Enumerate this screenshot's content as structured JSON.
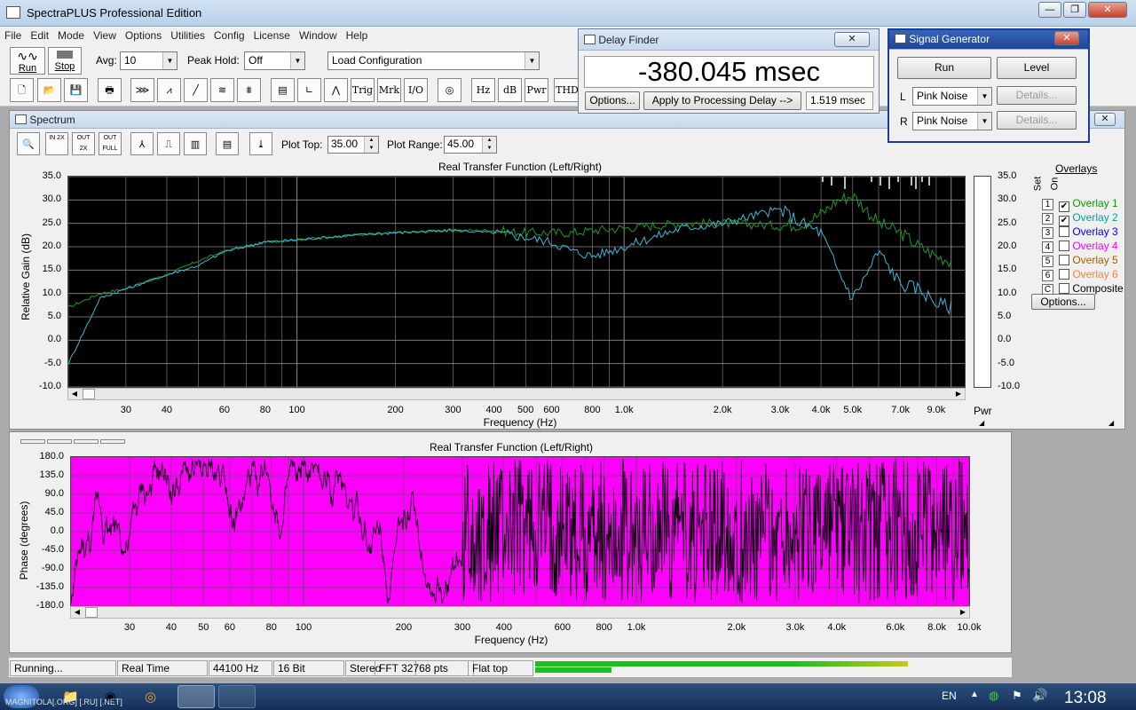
{
  "app": {
    "title": "SpectraPLUS Professional Edition"
  },
  "menu": [
    "File",
    "Edit",
    "Mode",
    "View",
    "Options",
    "Utilities",
    "Config",
    "License",
    "Window",
    "Help"
  ],
  "toolbar": {
    "run_label": "Run",
    "stop_label": "Stop",
    "avg_label": "Avg:",
    "avg_value": "10",
    "peak_hold_label": "Peak Hold:",
    "peak_hold_value": "Off",
    "config_value": "Load Configuration",
    "text_buttons": [
      "Trig",
      "Mrk",
      "I/O",
      "Hz",
      "dB",
      "Pwr",
      "THD"
    ]
  },
  "spectrum": {
    "window_title": "Spectrum",
    "plot_top_label": "Plot Top:",
    "plot_top_value": "35.00",
    "plot_range_label": "Plot Range:",
    "plot_range_value": "45.00",
    "mini_buttons": [
      "IN 2X",
      "OUT 2X",
      "OUT FULL"
    ],
    "pwr_label": "Pwr",
    "overlays": {
      "title": "Overlays",
      "set_label": "Set",
      "on_label": "On",
      "rows": [
        {
          "num": "1",
          "label": "Overlay 1",
          "checked": true,
          "color": "#00a000"
        },
        {
          "num": "2",
          "label": "Overlay 2",
          "checked": true,
          "color": "#00a0a0"
        },
        {
          "num": "3",
          "label": "Overlay 3",
          "checked": false,
          "color": "#0000ff"
        },
        {
          "num": "4",
          "label": "Overlay 4",
          "checked": false,
          "color": "#ff00ff"
        },
        {
          "num": "5",
          "label": "Overlay 5",
          "checked": false,
          "color": "#a06000"
        },
        {
          "num": "6",
          "label": "Overlay 6",
          "checked": false,
          "color": "#ff8040"
        },
        {
          "num": "C",
          "label": "Composite",
          "checked": false,
          "color": "#000000"
        }
      ],
      "options_label": "Options..."
    }
  },
  "delay_finder": {
    "title": "Delay Finder",
    "value": "-380.045 msec",
    "options_label": "Options...",
    "apply_label": "Apply to Processing Delay -->",
    "delay_value": "1.519 msec"
  },
  "signal_generator": {
    "title": "Signal Generator",
    "run_label": "Run",
    "level_label": "Level",
    "left_label": "L",
    "right_label": "R",
    "left_value": "Pink Noise",
    "right_value": "Pink Noise",
    "details_label": "Details..."
  },
  "chart_data": [
    {
      "type": "line",
      "title": "Real Transfer Function (Left/Right)",
      "xlabel": "Frequency (Hz)",
      "ylabel": "Relative Gain (dB)",
      "x_scale": "log",
      "xlim": [
        20,
        11000
      ],
      "ylim": [
        -10,
        35
      ],
      "y_ticks": [
        "35.0",
        "30.0",
        "25.0",
        "20.0",
        "15.0",
        "10.0",
        "5.0",
        "0.0",
        "-5.0",
        "-10.0"
      ],
      "x_ticks": [
        "30",
        "40",
        "60",
        "80",
        "100",
        "200",
        "300",
        "400",
        "500",
        "600",
        "800",
        "1.0k",
        "2.0k",
        "3.0k",
        "4.0k",
        "5.0k",
        "7.0k",
        "9.0k"
      ],
      "grid": true,
      "background": "#000000",
      "series": [
        {
          "color": "#1e9a1e",
          "x": [
            20,
            25,
            30,
            40,
            50,
            60,
            80,
            100,
            150,
            200,
            300,
            400,
            500,
            600,
            700,
            800,
            1000,
            1500,
            2000,
            3000,
            3500,
            4000,
            4500,
            5000,
            5500,
            6000,
            7000,
            8000,
            9000,
            10000
          ],
          "y": [
            7,
            10,
            11,
            14,
            17,
            19,
            21,
            21.5,
            22.5,
            23,
            23.5,
            23.5,
            23,
            23,
            23,
            23.5,
            24,
            25,
            25,
            24.5,
            25,
            27,
            30,
            31,
            28,
            25,
            23,
            20,
            18,
            17
          ]
        },
        {
          "color": "#3fb6d8",
          "x": [
            20,
            25,
            30,
            40,
            50,
            60,
            80,
            100,
            150,
            200,
            300,
            400,
            500,
            600,
            700,
            800,
            1000,
            1500,
            2000,
            3000,
            3500,
            4000,
            4500,
            5000,
            5500,
            6000,
            7000,
            8000,
            9000,
            10000
          ],
          "y": [
            -5,
            9,
            11,
            14,
            16,
            19,
            21,
            21.5,
            22.5,
            23,
            23.5,
            23,
            22,
            21,
            19,
            18,
            20,
            24,
            25,
            28,
            25,
            23,
            15,
            9,
            14,
            19,
            12,
            11,
            8,
            7
          ]
        }
      ]
    },
    {
      "type": "line",
      "title": "Real Transfer Function (Left/Right)",
      "xlabel": "Frequency (Hz)",
      "ylabel": "Phase (degrees)",
      "x_scale": "log",
      "xlim": [
        20,
        10000
      ],
      "ylim": [
        -180,
        180
      ],
      "y_ticks": [
        "180.0",
        "135.0",
        "90.0",
        "45.0",
        "0.0",
        "-45.0",
        "-90.0",
        "-135.0",
        "-180.0"
      ],
      "x_ticks": [
        "30",
        "40",
        "50",
        "60",
        "80",
        "100",
        "200",
        "300",
        "400",
        "600",
        "800",
        "1.0k",
        "2.0k",
        "3.0k",
        "4.0k",
        "6.0k",
        "8.0k",
        "10.0k"
      ],
      "grid": true,
      "background": "#ff00ff"
    }
  ],
  "status": {
    "state": "Running...",
    "mode": "Real Time",
    "rate": "44100 Hz",
    "bits": "16 Bit",
    "channels": "Stereo",
    "fft": "FFT 32768 pts",
    "window": "Flat top"
  },
  "taskbar": {
    "lang": "EN",
    "time": "13:08",
    "watermark": "MAGNITOLA[.ORG] [.RU] [.NET]"
  }
}
